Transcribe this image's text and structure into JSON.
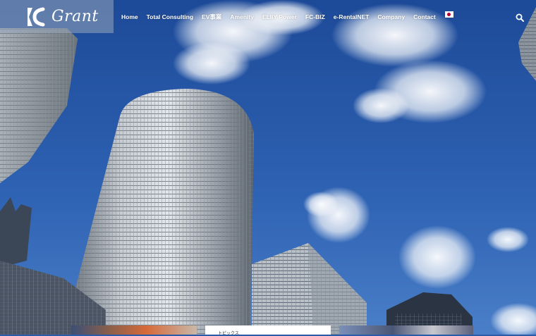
{
  "brand": {
    "logo_text": "Grant"
  },
  "nav": {
    "items": [
      {
        "label": "Home"
      },
      {
        "label": "Total Consulting"
      },
      {
        "label": "EV事業"
      },
      {
        "label": "Amenity"
      },
      {
        "label": "ELIIY Power"
      },
      {
        "label": "FC-BIZ"
      },
      {
        "label": "e-RentalNET"
      },
      {
        "label": "Company"
      },
      {
        "label": "Contact"
      }
    ],
    "language_flag": "japan-flag",
    "search_icon": "search-icon"
  },
  "theme": {
    "sky_top": "#1f4f9e",
    "sky_bottom": "#3b73c4",
    "nav_text": "#ffffff"
  },
  "cards": [
    {
      "label": ""
    },
    {
      "label": "トピックス"
    },
    {
      "label": ""
    }
  ]
}
